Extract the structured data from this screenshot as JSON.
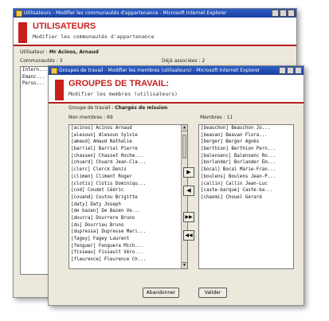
{
  "back_window": {
    "titlebar": "Utilisateurs - Modifier les communautés d'appartenance - Microsoft Internet Explorer",
    "header_title": "UTILISATEURS",
    "header_subtitle": "Modifier les communautés d'appartenance",
    "user_label": "Utilisateur :",
    "user_value": "Mr Acinos, Arnaud",
    "communities_label": "Communautés : 3",
    "associated_label": "Déjà associées : 2",
    "list_items": [
      "Intern...",
      "Emanc...",
      "Perso..."
    ]
  },
  "front_window": {
    "titlebar": "Groupes de travail - Modifier les membres (utilisateurs) - Microsoft Internet Explorer",
    "header_title": "GROUPES DE TRAVAIL:",
    "header_subtitle": "Modifier les membres (utilisateurs)",
    "group_label": "Groupe de travail :",
    "group_value": "Chargés de mission",
    "non_members_label": "Non membres : 69",
    "members_label": "Membres : 11",
    "non_members": [
      "[acinos] Acinos Arnaud",
      "[alesoun] Alesoun Sylvie",
      "[amaud] Amaud Nathalie",
      "[barriel] Barriel Pierre",
      "[chassen] Chasset Roche...",
      "[chuard] Chuard Jean-Cla...",
      "[clerc] Clerck Denis",
      "[climen] Climent Roger",
      "[clotis] Clotis Dominiqu...",
      "[cod] Coudet Cédric",
      "[couand] Coutou Brigitte",
      "[daty] Daty Joseph",
      "[de bazen] De Bazen Ve...",
      "[dourra] Dourrere Bruno",
      "[du] Dourrieu Bruno",
      "[dupressa] Dupresse Mari...",
      "[fagey] Fagey Laurent",
      "[fenguer] Fenguera Mich...",
      "[fisseau] Fissault Véro...",
      "[fleurence] Fleurence Ch..."
    ],
    "members": [
      "[beauchon] Beauchon Jo...",
      "[beavan] Beavan Flora...",
      "[berger] Berger Agnès",
      "[berthion] Berthion Pern...",
      "[balensenc] Balensenc Ro...",
      "[borlander] Borlander Em...",
      "[bocal] Bocal Marie-Fran...",
      "[boulens] Boulens Jean-P...",
      "[callin] Callin Jean-Luc",
      "[caste-barque] Caste-ba...",
      "[chaomi] Chouel Gerard"
    ],
    "move_right_one": "▶",
    "move_left_one": "◀",
    "move_right_all": "▶▶",
    "move_left_all": "◀◀",
    "cancel_label": "Abandonner",
    "validate_label": "Valider"
  }
}
